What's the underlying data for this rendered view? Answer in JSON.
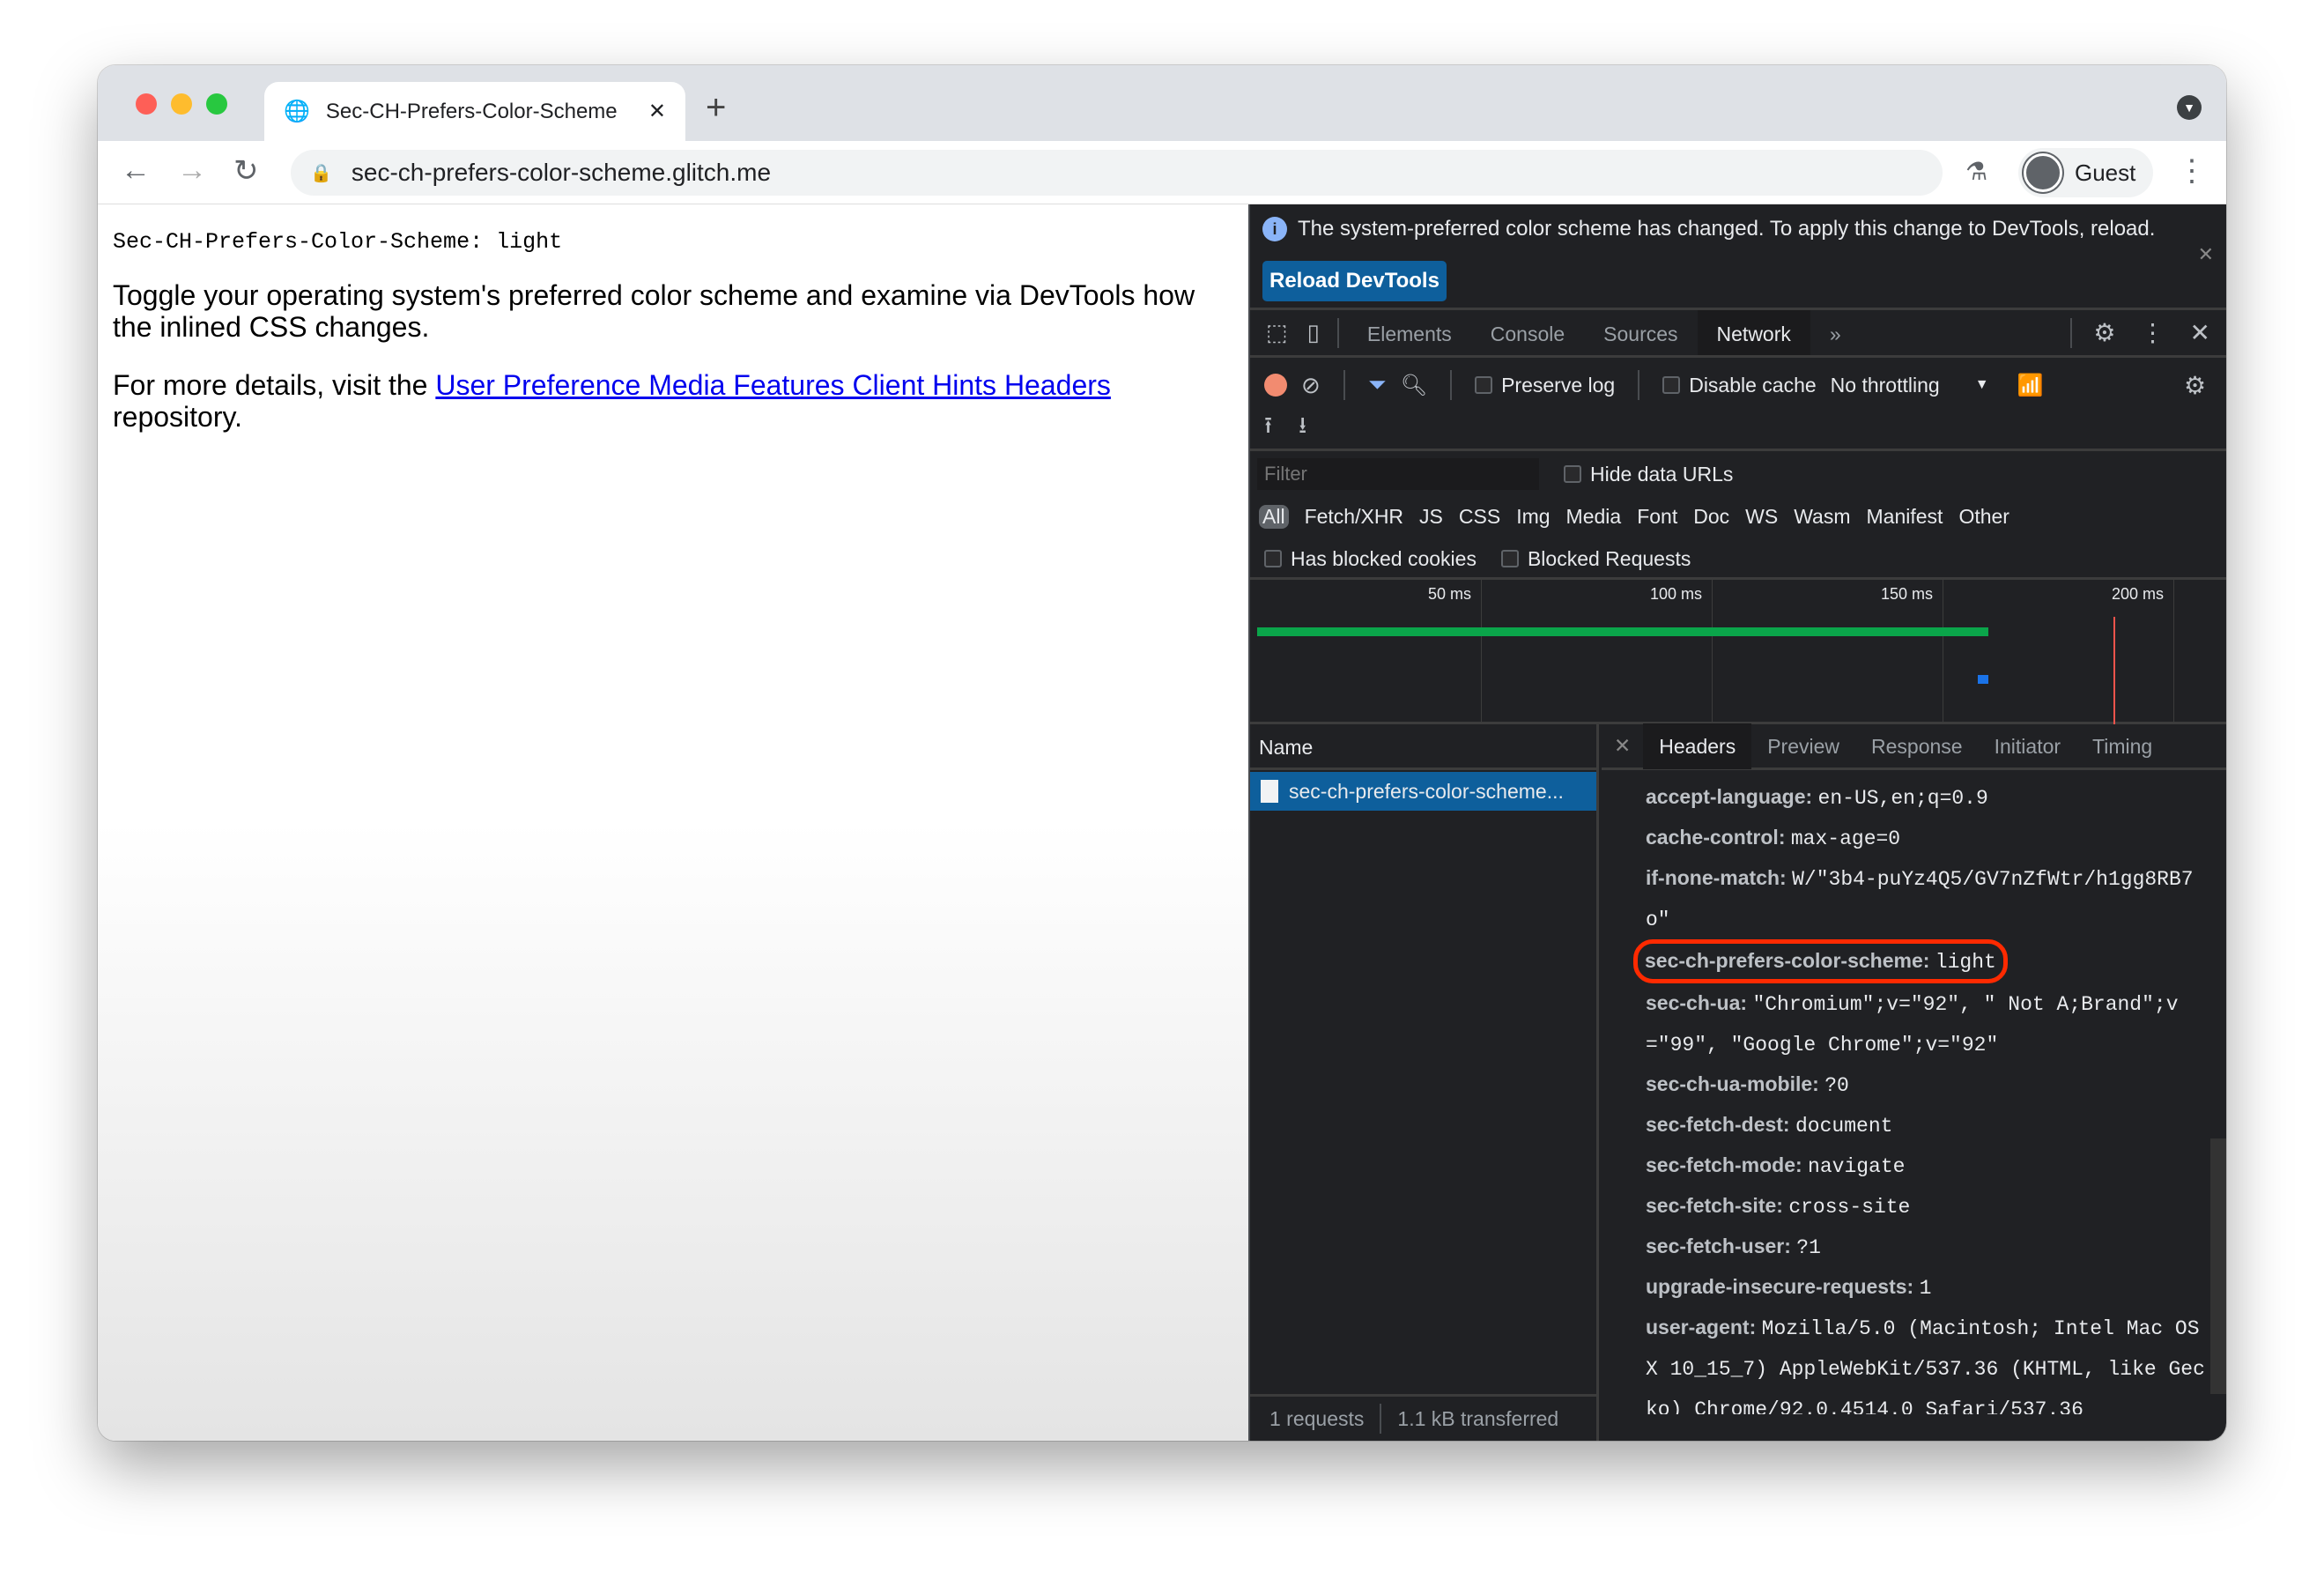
{
  "browser": {
    "tab_title": "Sec-CH-Prefers-Color-Scheme",
    "url": "sec-ch-prefers-color-scheme.glitch.me",
    "profile": "Guest"
  },
  "page": {
    "mono_line": "Sec-CH-Prefers-Color-Scheme: light",
    "para1": "Toggle your operating system's preferred color scheme and examine via DevTools how the inlined CSS changes.",
    "para2_pre": "For more details, visit the ",
    "para2_link": "User Preference Media Features Client Hints Headers",
    "para2_post": " repository."
  },
  "devtools": {
    "info_message": "The system-preferred color scheme has changed. To apply this change to DevTools, reload.",
    "reload_button": "Reload DevTools",
    "tabs": [
      "Elements",
      "Console",
      "Sources",
      "Network"
    ],
    "active_tab": "Network",
    "preserve_log": "Preserve log",
    "disable_cache": "Disable cache",
    "throttling": "No throttling",
    "filter_placeholder": "Filter",
    "hide_data_urls": "Hide data URLs",
    "types": [
      "All",
      "Fetch/XHR",
      "JS",
      "CSS",
      "Img",
      "Media",
      "Font",
      "Doc",
      "WS",
      "Wasm",
      "Manifest",
      "Other"
    ],
    "has_blocked_cookies": "Has blocked cookies",
    "blocked_requests": "Blocked Requests",
    "timeline_ticks": [
      "50 ms",
      "100 ms",
      "150 ms",
      "200 ms"
    ],
    "name_header": "Name",
    "request_name": "sec-ch-prefers-color-scheme...",
    "detail_tabs": [
      "Headers",
      "Preview",
      "Response",
      "Initiator",
      "Timing"
    ],
    "headers": [
      {
        "name": "accept-language:",
        "value": "en-US,en;q=0.9"
      },
      {
        "name": "cache-control:",
        "value": "max-age=0"
      },
      {
        "name": "if-none-match:",
        "value": "W/\"3b4-puYz4Q5/GV7nZfWtr/h1gg8RB7o\""
      },
      {
        "name": "sec-ch-prefers-color-scheme:",
        "value": "light"
      },
      {
        "name": "sec-ch-ua:",
        "value": "\"Chromium\";v=\"92\", \" Not A;Brand\";v=\"99\", \"Google Chrome\";v=\"92\""
      },
      {
        "name": "sec-ch-ua-mobile:",
        "value": "?0"
      },
      {
        "name": "sec-fetch-dest:",
        "value": "document"
      },
      {
        "name": "sec-fetch-mode:",
        "value": "navigate"
      },
      {
        "name": "sec-fetch-site:",
        "value": "cross-site"
      },
      {
        "name": "sec-fetch-user:",
        "value": "?1"
      },
      {
        "name": "upgrade-insecure-requests:",
        "value": "1"
      },
      {
        "name": "user-agent:",
        "value": "Mozilla/5.0 (Macintosh; Intel Mac OS X 10_15_7) AppleWebKit/537.36 (KHTML, like Gecko) Chrome/92.0.4514.0 Safari/537.36"
      }
    ],
    "footer_requests": "1 requests",
    "footer_transferred": "1.1 kB transferred"
  }
}
